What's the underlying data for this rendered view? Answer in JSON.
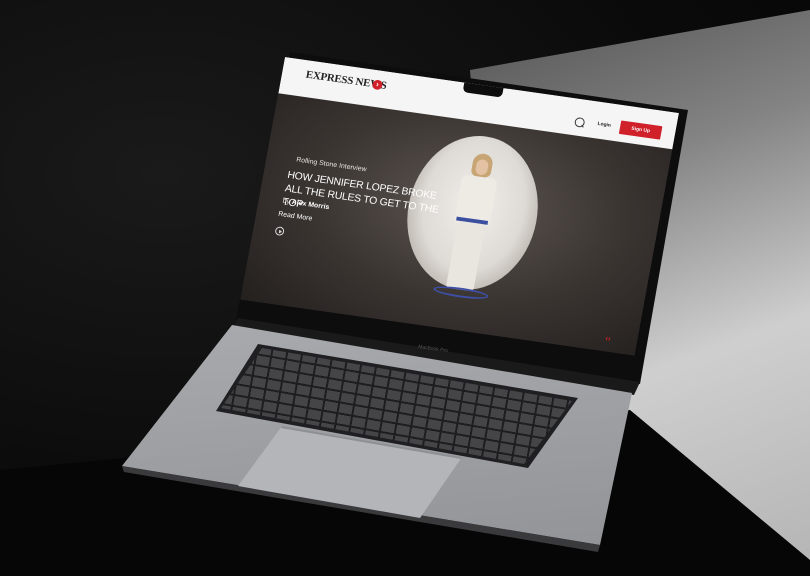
{
  "site": {
    "logo": "EXPRESS NEWS",
    "logo_mark": "›",
    "header": {
      "login_label": "Login",
      "signup_label": "Sign Up"
    }
  },
  "hero": {
    "kicker": "Rolling Stone Interview",
    "headline": "HOW JENNIFER LOPEZ BROKE ALL THE RULES TO GET TO THE TOP",
    "byline_prefix": "by",
    "author": "Alex Morris",
    "read_more": "Read More",
    "nav_arrows": "‹›"
  },
  "device": {
    "brand_label": "MacBook Pro"
  },
  "colors": {
    "accent": "#d0202a",
    "header_bg": "#f5f5f5",
    "hero_bg": "#3b3633"
  },
  "icons": [
    "search-icon",
    "play-icon",
    "arrow-icon"
  ]
}
